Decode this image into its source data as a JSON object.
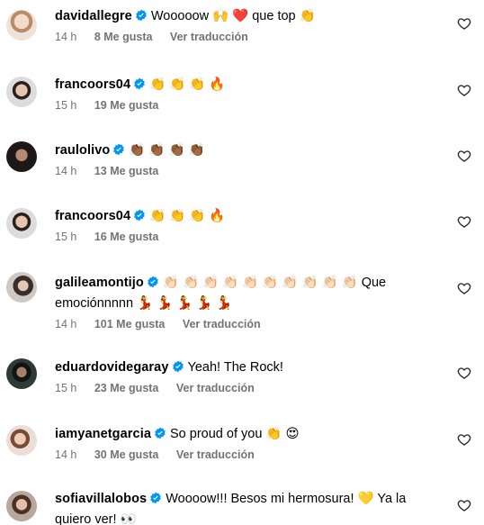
{
  "comments": [
    {
      "username": "davidallegre",
      "text": "Wooooow 🙌 ❤️  que top  👏",
      "time": "14 h",
      "likes": "8 Me gusta",
      "translate": "Ver traducción",
      "avatar_color": "#e9c9b5"
    },
    {
      "username": "francoors04",
      "text": "👏 👏 👏 🔥",
      "time": "15 h",
      "likes": "19 Me gusta",
      "translate": "",
      "avatar_color": "#c9b7a9"
    },
    {
      "username": "raulolivo",
      "text": "👏🏾 👏🏾 👏🏾 👏🏾",
      "time": "14 h",
      "likes": "13 Me gusta",
      "translate": "",
      "avatar_color": "#3b3330"
    },
    {
      "username": "francoors04",
      "text": "👏 👏 👏 🔥",
      "time": "15 h",
      "likes": "16 Me gusta",
      "translate": "",
      "avatar_color": "#c9b7a9"
    },
    {
      "username": "galileamontijo",
      "text": "👏🏻 👏🏻 👏🏻 👏🏻 👏🏻 👏🏻 👏🏻 👏🏻 👏🏻 👏🏻  Que emociónnnnn 💃 💃 💃 💃 💃",
      "time": "14 h",
      "likes": "101 Me gusta",
      "translate": "Ver traducción",
      "avatar_color": "#d8d2cf"
    },
    {
      "username": "eduardovidegaray",
      "text": "Yeah! The Rock!",
      "time": "15 h",
      "likes": "23 Me gusta",
      "translate": "Ver traducción",
      "avatar_color": "#1f2a26"
    },
    {
      "username": "iamyanetgarcia",
      "text": "So proud of you  👏 😍",
      "time": "14 h",
      "likes": "30 Me gusta",
      "translate": "Ver traducción",
      "avatar_color": "#d9a98d"
    },
    {
      "username": "sofiavillalobos",
      "text": "Woooow!!! Besos mi hermosura!  💛  Ya la quiero ver! 👀",
      "time": "",
      "likes": "",
      "translate": "",
      "avatar_color": "#8a6a5a"
    }
  ],
  "colors": {
    "verified": "#0095f6",
    "meta": "#737373",
    "heart": "#262626"
  }
}
